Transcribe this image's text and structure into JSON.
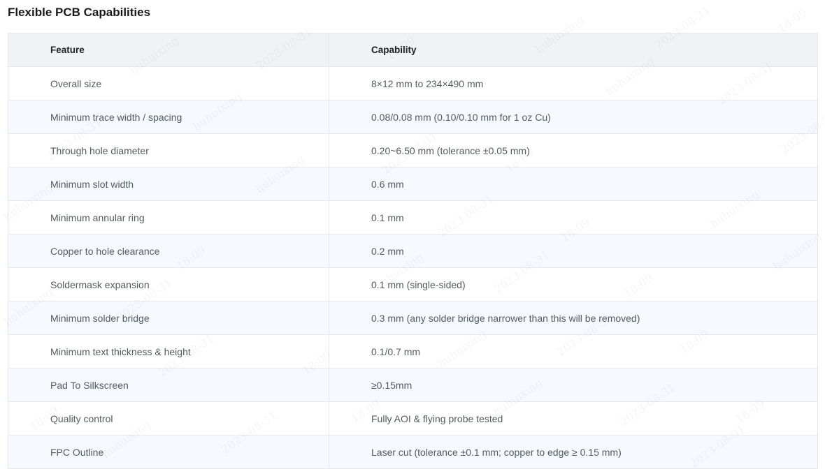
{
  "title": "Flexible PCB Capabilities",
  "table": {
    "headers": {
      "feature": "Feature",
      "capability": "Capability"
    },
    "rows": [
      {
        "feature": "Overall size",
        "capability": "8×12 mm to 234×490 mm"
      },
      {
        "feature": "Minimum trace width / spacing",
        "capability": "0.08/0.08 mm (0.10/0.10 mm for 1 oz Cu)"
      },
      {
        "feature": "Through hole diameter",
        "capability": "0.20~6.50 mm (tolerance ±0.05 mm)"
      },
      {
        "feature": "Minimum slot width",
        "capability": "0.6 mm"
      },
      {
        "feature": "Minimum annular ring",
        "capability": "0.1 mm"
      },
      {
        "feature": "Copper to hole clearance",
        "capability": "0.2 mm"
      },
      {
        "feature": "Soldermask expansion",
        "capability": "0.1 mm (single-sided)"
      },
      {
        "feature": "Minimum solder bridge",
        "capability": "0.3 mm (any solder bridge narrower than this will be removed)"
      },
      {
        "feature": "Minimum text thickness & height",
        "capability": "0.1/0.7 mm"
      },
      {
        "feature": "Pad To Silkscreen",
        "capability": "≥0.15mm"
      },
      {
        "feature": "Quality control",
        "capability": "Fully AOI & flying probe tested"
      },
      {
        "feature": "FPC Outline",
        "capability": "Laser cut (tolerance ±0.1 mm; copper to edge ≥ 0.15 mm)"
      }
    ]
  },
  "watermark": {
    "words": [
      "huhuixing",
      "2023-08-31",
      "18:09"
    ]
  }
}
